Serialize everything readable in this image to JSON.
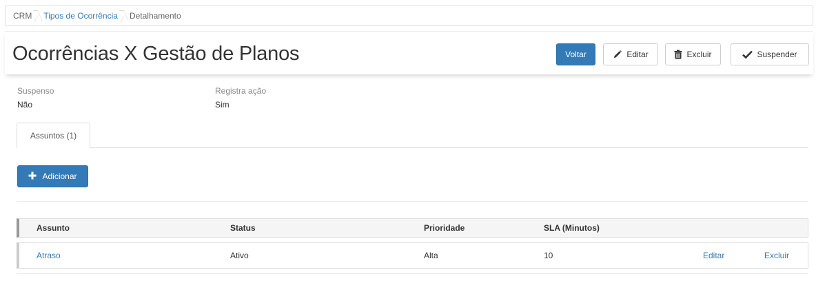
{
  "breadcrumb": {
    "root": "CRM",
    "parent": "Tipos de Ocorrência",
    "current": "Detalhamento"
  },
  "header": {
    "title": "Ocorrências X Gestão de Planos",
    "back_label": "Voltar",
    "edit_label": "Editar",
    "delete_label": "Excluir",
    "suspend_label": "Suspender"
  },
  "details": {
    "suspenso_label": "Suspenso",
    "suspenso_value": "Não",
    "registra_label": "Registra ação",
    "registra_value": "Sim"
  },
  "tabs": [
    {
      "label": "Assuntos (1)",
      "active": true
    }
  ],
  "actions": {
    "add_label": "Adicionar"
  },
  "table": {
    "headers": [
      "Assunto",
      "Status",
      "Prioridade",
      "SLA (Minutos)"
    ],
    "rows": [
      {
        "assunto": "Atraso",
        "status": "Ativo",
        "prioridade": "Alta",
        "sla": "10",
        "edit_label": "Editar",
        "delete_label": "Excluir"
      }
    ]
  },
  "colors": {
    "primary": "#337ab7",
    "link": "#337ab7",
    "border": "#dddddd"
  },
  "icons": {
    "edit": "pencil-icon",
    "delete": "trash-icon",
    "suspend": "check-icon",
    "add": "plus-icon"
  }
}
